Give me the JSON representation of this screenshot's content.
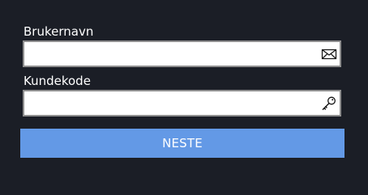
{
  "form": {
    "username": {
      "label": "Brukernavn",
      "value": "",
      "placeholder": "",
      "icon": "envelope-icon"
    },
    "customer_code": {
      "label": "Kundekode",
      "value": "",
      "placeholder": "",
      "icon": "key-icon"
    },
    "next_button_label": "NESTE"
  },
  "colors": {
    "background": "#1b1e26",
    "button": "#6399e6",
    "field_border": "#8f8f8f"
  }
}
